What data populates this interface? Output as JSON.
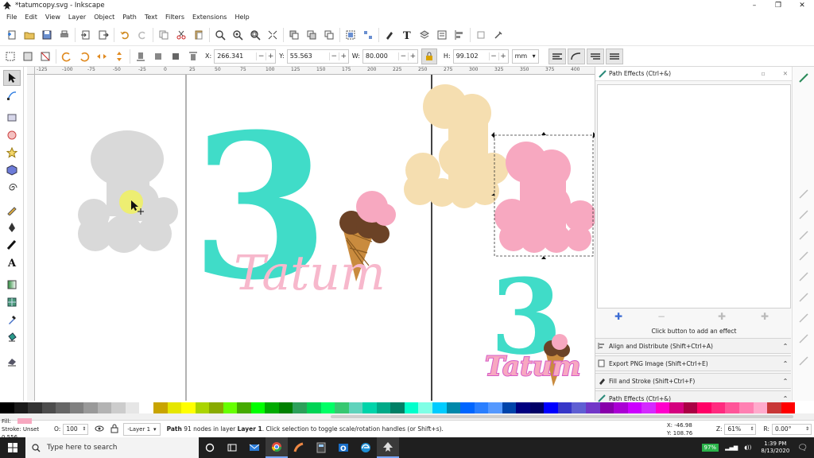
{
  "window": {
    "title": "*tatumcopy.svg - Inkscape",
    "controls": [
      "–",
      "❐",
      "✕"
    ]
  },
  "menu": [
    "File",
    "Edit",
    "View",
    "Layer",
    "Object",
    "Path",
    "Text",
    "Filters",
    "Extensions",
    "Help"
  ],
  "controls_bar": {
    "x_label": "X:",
    "x_value": "266.341",
    "y_label": "Y:",
    "y_value": "55.563",
    "w_label": "W:",
    "w_value": "80.000",
    "h_label": "H:",
    "h_value": "99.102",
    "unit": "mm"
  },
  "ruler": {
    "labels": [
      "-125",
      "-100",
      "-75",
      "-50",
      "-25",
      "0",
      "25",
      "50",
      "75",
      "100",
      "125",
      "150",
      "175",
      "200",
      "225",
      "250",
      "275",
      "300",
      "325",
      "350",
      "375",
      "400"
    ]
  },
  "canvas": {
    "artwork_text": "Tatum",
    "numeral": "3"
  },
  "panel": {
    "tab_title": "Path Effects (Ctrl+&)",
    "hint": "Click button to add an effect",
    "docked": [
      "Align and Distribute (Shift+Ctrl+A)",
      "Export PNG Image (Shift+Ctrl+E)",
      "Fill and Stroke (Shift+Ctrl+F)",
      "Path Effects (Ctrl+&)"
    ]
  },
  "palette": {
    "colors": [
      "#000000",
      "#1a1a1a",
      "#333333",
      "#4d4d4d",
      "#666666",
      "#808080",
      "#999999",
      "#b3b3b3",
      "#cccccc",
      "#e6e6e6",
      "#ffffff",
      "#c8a400",
      "#e6e600",
      "#ffff00",
      "#aad400",
      "#88aa00",
      "#66ff00",
      "#44aa00",
      "#00ff00",
      "#00aa00",
      "#008000",
      "#2ca05a",
      "#00d455",
      "#00ff66",
      "#37c871",
      "#5fd3bc",
      "#00d4aa",
      "#00aa88",
      "#008066",
      "#00ffcc",
      "#80ffe6",
      "#00ccff",
      "#0088aa",
      "#0066ff",
      "#2a7fff",
      "#5599ff",
      "#0044aa",
      "#000080",
      "#000066",
      "#0000ff",
      "#3737c8",
      "#5f5fd3",
      "#7137c8",
      "#8800aa",
      "#aa00d4",
      "#cc00ff",
      "#d42aff",
      "#ff00cc",
      "#d4007f",
      "#aa0044",
      "#ff0066",
      "#ff2a7f",
      "#ff5599",
      "#ff80b2",
      "#ffaacc",
      "#c83737",
      "#ff0000"
    ]
  },
  "status": {
    "fill_label": "Fill:",
    "stroke_label": "Stroke:",
    "stroke_value": "Unset 0.556",
    "opacity_label": "O:",
    "opacity_value": "100",
    "layer": "-Layer 1",
    "message_prefix": "Path",
    "message": "91 nodes in layer",
    "message_layer": "Layer 1",
    "message_suffix": ". Click selection to toggle scale/rotation handles (or Shift+s).",
    "x_label": "X:",
    "x_coord": "-46.98",
    "y_label": "Y:",
    "y_coord": "108.76",
    "zoom_label": "Z:",
    "zoom": "61%",
    "rot_label": "R:",
    "rotation": "0.00°"
  },
  "taskbar": {
    "search_placeholder": "Type here to search",
    "battery": "97%",
    "time": "1:39 PM",
    "date": "8/13/2020"
  },
  "colors": {
    "teal": "#40dcc8",
    "pink": "#f7a8c0",
    "tan": "#f5deb0",
    "gray": "#d9d9d9",
    "magenta": "#d65bc8",
    "chocolate": "#6b4226",
    "cone": "#c98b3e"
  }
}
